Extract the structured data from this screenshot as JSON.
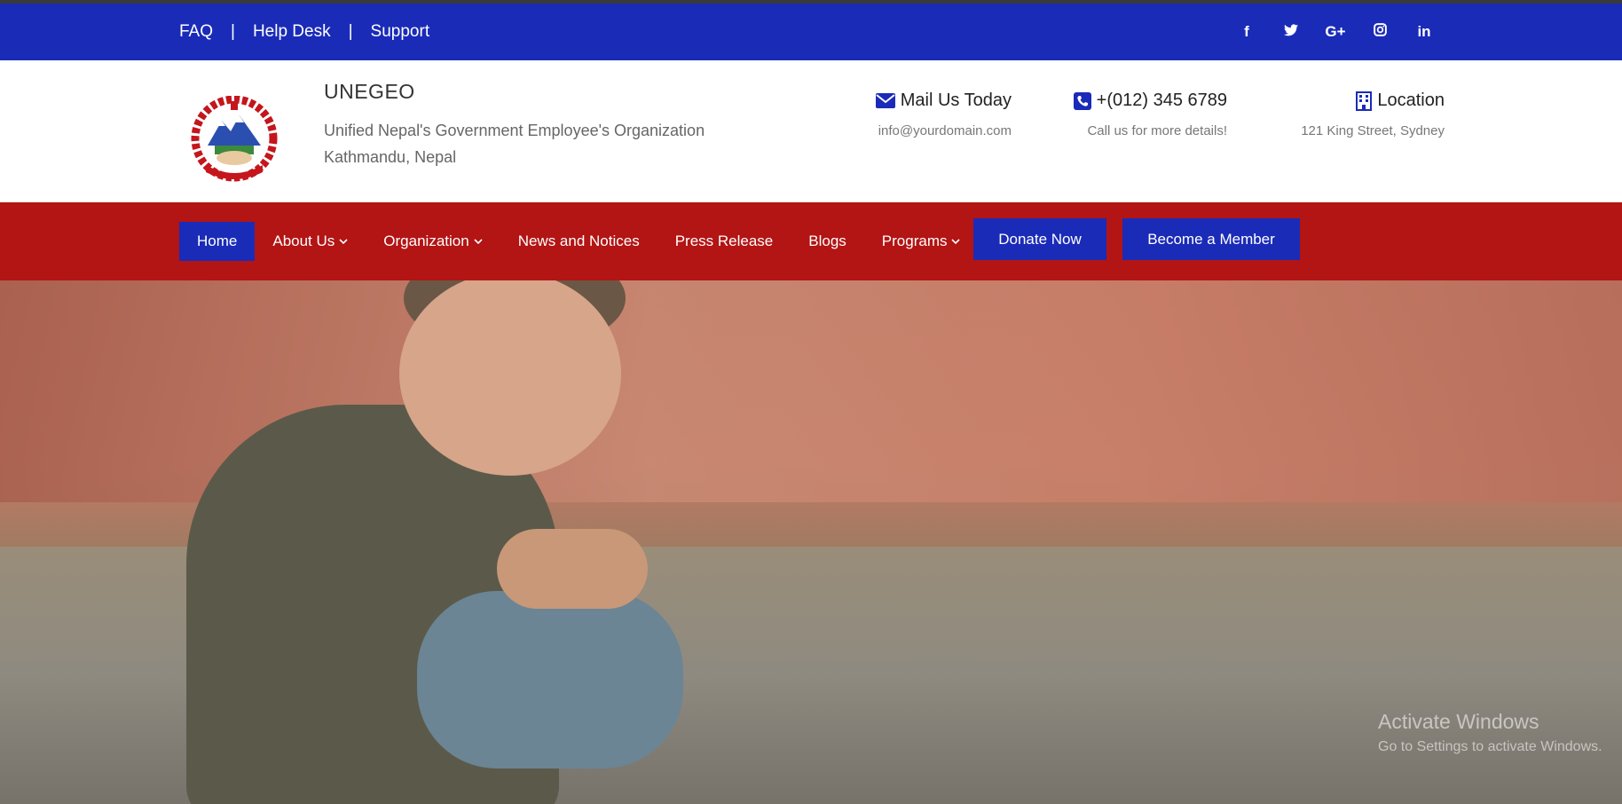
{
  "topbar": {
    "links": [
      "FAQ",
      "Help Desk",
      "Support"
    ],
    "separator": "|",
    "social": [
      {
        "icon": "facebook-icon",
        "glyph": "f"
      },
      {
        "icon": "twitter-icon",
        "glyph": "🐦"
      },
      {
        "icon": "google-plus-icon",
        "glyph": "G+"
      },
      {
        "icon": "instagram-icon",
        "glyph": "◎"
      },
      {
        "icon": "linkedin-icon",
        "glyph": "in"
      }
    ]
  },
  "header": {
    "title": "UNEGEO",
    "subtitle_line1": "Unified Nepal's Government Employee's Organization",
    "subtitle_line2": "Kathmandu, Nepal",
    "mail": {
      "title": "Mail Us Today",
      "detail": "info@yourdomain.com",
      "icon": "envelope-icon"
    },
    "phone": {
      "title": "+(012) 345 6789",
      "detail": "Call us for more details!",
      "icon": "phone-icon"
    },
    "location": {
      "title": "Location",
      "detail": "121 King Street, Sydney",
      "icon": "building-icon"
    }
  },
  "nav": {
    "items": [
      {
        "label": "Home",
        "active": true,
        "dropdown": false
      },
      {
        "label": "About Us",
        "dropdown": true
      },
      {
        "label": "Organization",
        "dropdown": true
      },
      {
        "label": "News and Notices",
        "dropdown": false
      },
      {
        "label": "Press Release",
        "dropdown": false
      },
      {
        "label": "Blogs",
        "dropdown": false
      },
      {
        "label": "Programs",
        "dropdown": true
      }
    ],
    "donate": "Donate Now",
    "member": "Become a Member"
  },
  "watermark": {
    "line1": "Activate Windows",
    "line2": "Go to Settings to activate Windows."
  },
  "colors": {
    "primary_blue": "#1a2bb8",
    "nav_red": "#b31414"
  }
}
